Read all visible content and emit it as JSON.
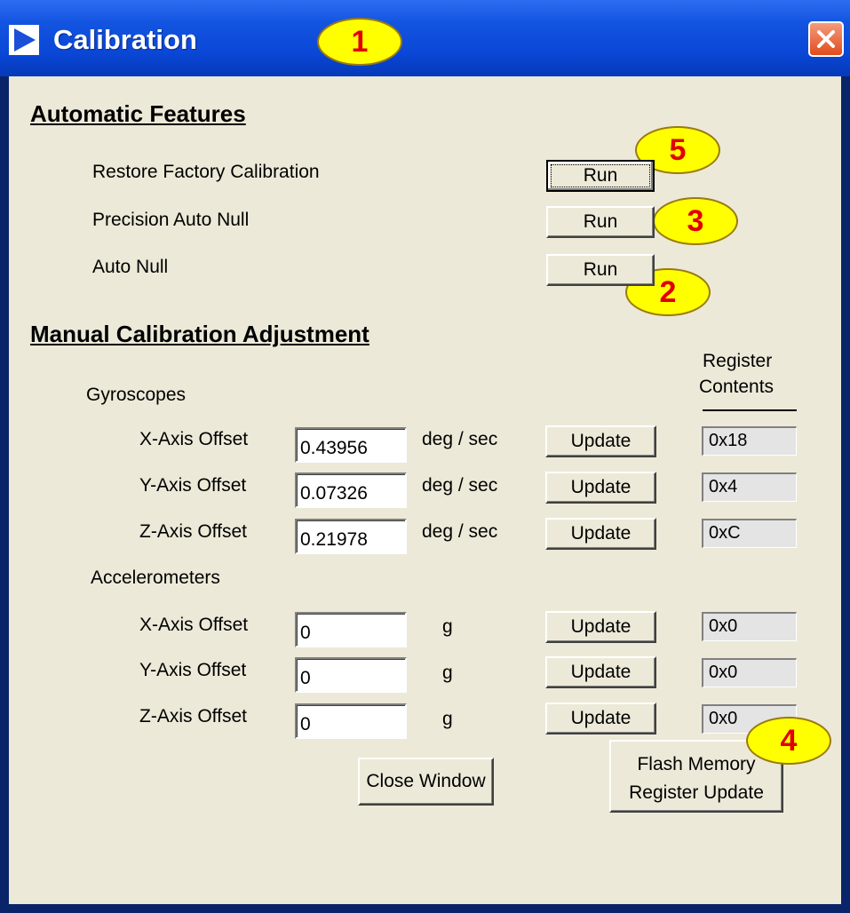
{
  "window": {
    "title": "Calibration"
  },
  "callouts": [
    "1",
    "2",
    "3",
    "4",
    "5"
  ],
  "automatic": {
    "heading": "Automatic Features",
    "rows": [
      {
        "label": "Restore Factory Calibration",
        "button": "Run"
      },
      {
        "label": "Precision Auto Null",
        "button": "Run"
      },
      {
        "label": "Auto Null",
        "button": "Run"
      }
    ]
  },
  "manual": {
    "heading": "Manual Calibration Adjustment",
    "register_header": {
      "line1": "Register",
      "line2": "Contents"
    },
    "gyroscopes": {
      "title": "Gyroscopes",
      "rows": [
        {
          "label": "X-Axis Offset",
          "value": "0.43956",
          "unit": "deg / sec",
          "button": "Update",
          "register": "0x18"
        },
        {
          "label": "Y-Axis Offset",
          "value": "0.07326",
          "unit": "deg / sec",
          "button": "Update",
          "register": "0x4"
        },
        {
          "label": "Z-Axis Offset",
          "value": "0.21978",
          "unit": "deg / sec",
          "button": "Update",
          "register": "0xC"
        }
      ]
    },
    "accelerometers": {
      "title": "Accelerometers",
      "rows": [
        {
          "label": "X-Axis Offset",
          "value": "0",
          "unit": "g",
          "button": "Update",
          "register": "0x0"
        },
        {
          "label": "Y-Axis Offset",
          "value": "0",
          "unit": "g",
          "button": "Update",
          "register": "0x0"
        },
        {
          "label": "Z-Axis Offset",
          "value": "0",
          "unit": "g",
          "button": "Update",
          "register": "0x0"
        }
      ]
    }
  },
  "footer": {
    "close_label": "Close Window",
    "flash_line1": "Flash Memory",
    "flash_line2": "Register Update"
  },
  "colors": {
    "title_bar": "#0a47d6",
    "client_bg": "#ece9d8",
    "callout_fill": "#ffff00",
    "callout_text": "#e00000"
  }
}
